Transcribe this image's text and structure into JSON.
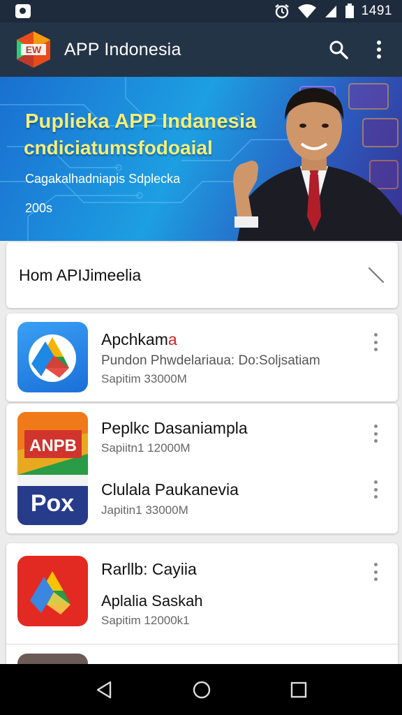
{
  "status_bar": {
    "time": "1491",
    "icons": [
      "notification-icon",
      "alarm-icon",
      "wifi-icon",
      "signal-icon",
      "battery-icon"
    ]
  },
  "app_bar": {
    "logo_text": "EW",
    "title": "APP Indonesia",
    "icons": [
      "search-icon",
      "more-vert-icon"
    ]
  },
  "banner": {
    "title": "Puplieka APP Indanesia",
    "subtitle": "cndiciatumsfodoaial",
    "caption": "Cagakalhadniapis Sdplecka",
    "year": "200s"
  },
  "section_header": {
    "title": "Hom APIJimeelia"
  },
  "apps": [
    {
      "name": "Apchkama",
      "name_accent": "a",
      "description": "Pundon Phwdelariaua: Do:Soljsatiam",
      "size": "Sapitim 33000M"
    },
    {
      "name": "Peplkc Dasaniamplа",
      "size": "Sapiitn1 12000M"
    },
    {
      "name": "Clulala Paukanevia",
      "size": "Japitin1 33000M"
    },
    {
      "name": "Rarllb: Cayiia",
      "subname": "Aplalia Saskah",
      "size": "Sapitim 12000k1"
    }
  ],
  "icon_labels": {
    "top": "ANPB",
    "bottom": "Pox"
  },
  "colors": {
    "status_bar": "#1e2b3c",
    "app_bar": "#243447",
    "banner_text": "#f4ee7a",
    "accent_red": "#d32020"
  },
  "nav_bar": {
    "icons": [
      "back-icon",
      "home-icon",
      "recents-icon"
    ]
  }
}
